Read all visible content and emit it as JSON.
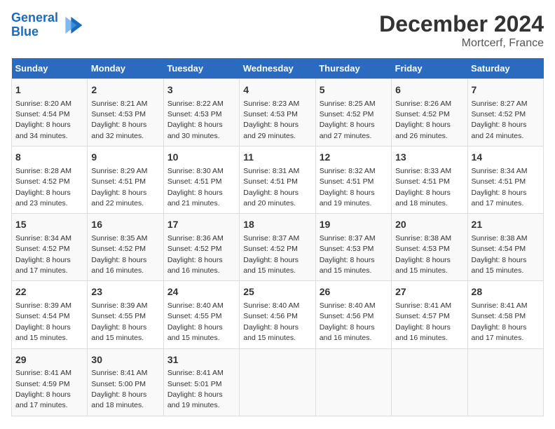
{
  "logo": {
    "line1": "General",
    "line2": "Blue"
  },
  "title": "December 2024",
  "subtitle": "Mortcerf, France",
  "days_header": [
    "Sunday",
    "Monday",
    "Tuesday",
    "Wednesday",
    "Thursday",
    "Friday",
    "Saturday"
  ],
  "weeks": [
    [
      {
        "day": "1",
        "info": "Sunrise: 8:20 AM\nSunset: 4:54 PM\nDaylight: 8 hours\nand 34 minutes."
      },
      {
        "day": "2",
        "info": "Sunrise: 8:21 AM\nSunset: 4:53 PM\nDaylight: 8 hours\nand 32 minutes."
      },
      {
        "day": "3",
        "info": "Sunrise: 8:22 AM\nSunset: 4:53 PM\nDaylight: 8 hours\nand 30 minutes."
      },
      {
        "day": "4",
        "info": "Sunrise: 8:23 AM\nSunset: 4:53 PM\nDaylight: 8 hours\nand 29 minutes."
      },
      {
        "day": "5",
        "info": "Sunrise: 8:25 AM\nSunset: 4:52 PM\nDaylight: 8 hours\nand 27 minutes."
      },
      {
        "day": "6",
        "info": "Sunrise: 8:26 AM\nSunset: 4:52 PM\nDaylight: 8 hours\nand 26 minutes."
      },
      {
        "day": "7",
        "info": "Sunrise: 8:27 AM\nSunset: 4:52 PM\nDaylight: 8 hours\nand 24 minutes."
      }
    ],
    [
      {
        "day": "8",
        "info": "Sunrise: 8:28 AM\nSunset: 4:52 PM\nDaylight: 8 hours\nand 23 minutes."
      },
      {
        "day": "9",
        "info": "Sunrise: 8:29 AM\nSunset: 4:51 PM\nDaylight: 8 hours\nand 22 minutes."
      },
      {
        "day": "10",
        "info": "Sunrise: 8:30 AM\nSunset: 4:51 PM\nDaylight: 8 hours\nand 21 minutes."
      },
      {
        "day": "11",
        "info": "Sunrise: 8:31 AM\nSunset: 4:51 PM\nDaylight: 8 hours\nand 20 minutes."
      },
      {
        "day": "12",
        "info": "Sunrise: 8:32 AM\nSunset: 4:51 PM\nDaylight: 8 hours\nand 19 minutes."
      },
      {
        "day": "13",
        "info": "Sunrise: 8:33 AM\nSunset: 4:51 PM\nDaylight: 8 hours\nand 18 minutes."
      },
      {
        "day": "14",
        "info": "Sunrise: 8:34 AM\nSunset: 4:51 PM\nDaylight: 8 hours\nand 17 minutes."
      }
    ],
    [
      {
        "day": "15",
        "info": "Sunrise: 8:34 AM\nSunset: 4:52 PM\nDaylight: 8 hours\nand 17 minutes."
      },
      {
        "day": "16",
        "info": "Sunrise: 8:35 AM\nSunset: 4:52 PM\nDaylight: 8 hours\nand 16 minutes."
      },
      {
        "day": "17",
        "info": "Sunrise: 8:36 AM\nSunset: 4:52 PM\nDaylight: 8 hours\nand 16 minutes."
      },
      {
        "day": "18",
        "info": "Sunrise: 8:37 AM\nSunset: 4:52 PM\nDaylight: 8 hours\nand 15 minutes."
      },
      {
        "day": "19",
        "info": "Sunrise: 8:37 AM\nSunset: 4:53 PM\nDaylight: 8 hours\nand 15 minutes."
      },
      {
        "day": "20",
        "info": "Sunrise: 8:38 AM\nSunset: 4:53 PM\nDaylight: 8 hours\nand 15 minutes."
      },
      {
        "day": "21",
        "info": "Sunrise: 8:38 AM\nSunset: 4:54 PM\nDaylight: 8 hours\nand 15 minutes."
      }
    ],
    [
      {
        "day": "22",
        "info": "Sunrise: 8:39 AM\nSunset: 4:54 PM\nDaylight: 8 hours\nand 15 minutes."
      },
      {
        "day": "23",
        "info": "Sunrise: 8:39 AM\nSunset: 4:55 PM\nDaylight: 8 hours\nand 15 minutes."
      },
      {
        "day": "24",
        "info": "Sunrise: 8:40 AM\nSunset: 4:55 PM\nDaylight: 8 hours\nand 15 minutes."
      },
      {
        "day": "25",
        "info": "Sunrise: 8:40 AM\nSunset: 4:56 PM\nDaylight: 8 hours\nand 15 minutes."
      },
      {
        "day": "26",
        "info": "Sunrise: 8:40 AM\nSunset: 4:56 PM\nDaylight: 8 hours\nand 16 minutes."
      },
      {
        "day": "27",
        "info": "Sunrise: 8:41 AM\nSunset: 4:57 PM\nDaylight: 8 hours\nand 16 minutes."
      },
      {
        "day": "28",
        "info": "Sunrise: 8:41 AM\nSunset: 4:58 PM\nDaylight: 8 hours\nand 17 minutes."
      }
    ],
    [
      {
        "day": "29",
        "info": "Sunrise: 8:41 AM\nSunset: 4:59 PM\nDaylight: 8 hours\nand 17 minutes."
      },
      {
        "day": "30",
        "info": "Sunrise: 8:41 AM\nSunset: 5:00 PM\nDaylight: 8 hours\nand 18 minutes."
      },
      {
        "day": "31",
        "info": "Sunrise: 8:41 AM\nSunset: 5:01 PM\nDaylight: 8 hours\nand 19 minutes."
      },
      null,
      null,
      null,
      null
    ]
  ]
}
